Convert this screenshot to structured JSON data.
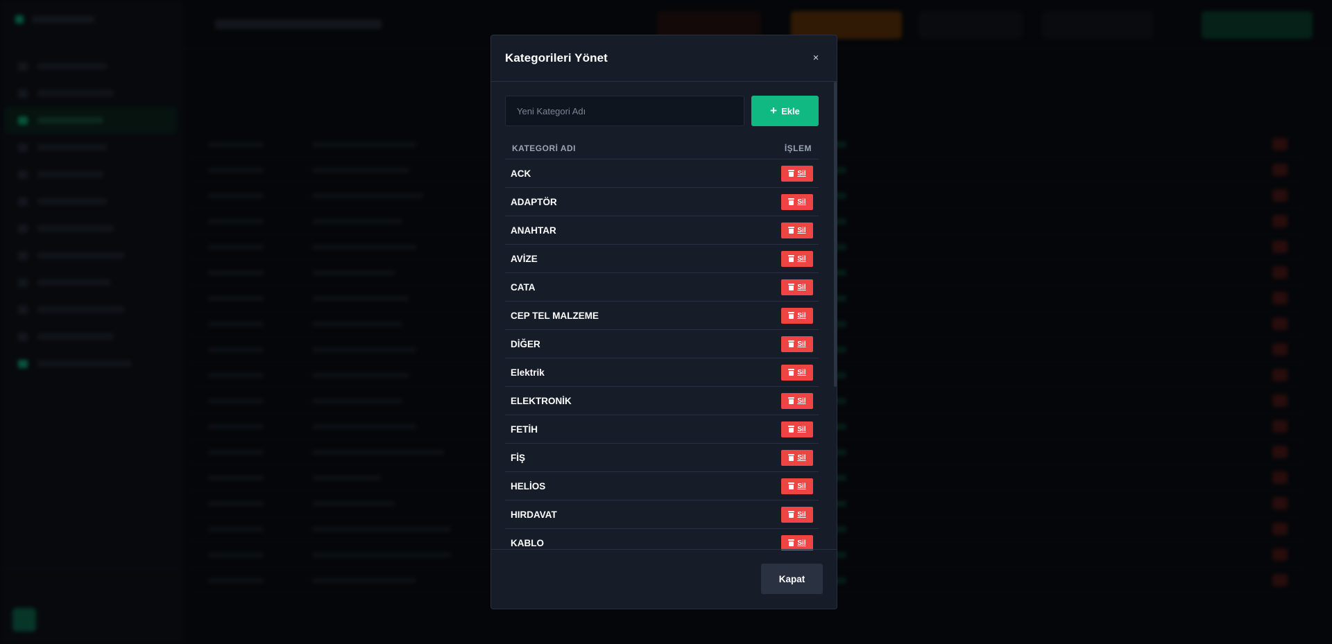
{
  "modal": {
    "title": "Kategorileri Yönet",
    "close_icon": "×",
    "input": {
      "placeholder": "Yeni Kategori Adı",
      "value": ""
    },
    "add_button": {
      "icon": "+",
      "label": "Ekle"
    },
    "table": {
      "headers": {
        "name": "KATEGORİ ADI",
        "action": "İŞLEM"
      },
      "delete_label": "Sil",
      "rows": [
        "ACK",
        "ADAPTÖR",
        "ANAHTAR",
        "AVİZE",
        "CATA",
        "CEP TEL MALZEME",
        "DİĞER",
        "Elektrik",
        "ELEKTRONİK",
        "FETİH",
        "FİŞ",
        "HELİOS",
        "HIRDAVAT",
        "KABLO"
      ]
    },
    "footer": {
      "close_label": "Kapat"
    }
  },
  "colors": {
    "accent": "#10b981",
    "danger": "#ef4444",
    "modal_bg": "#161d29",
    "page_bg": "#0b0f14"
  },
  "icons": {
    "add": "plus-icon",
    "delete": "trash-icon",
    "close": "close-icon"
  }
}
